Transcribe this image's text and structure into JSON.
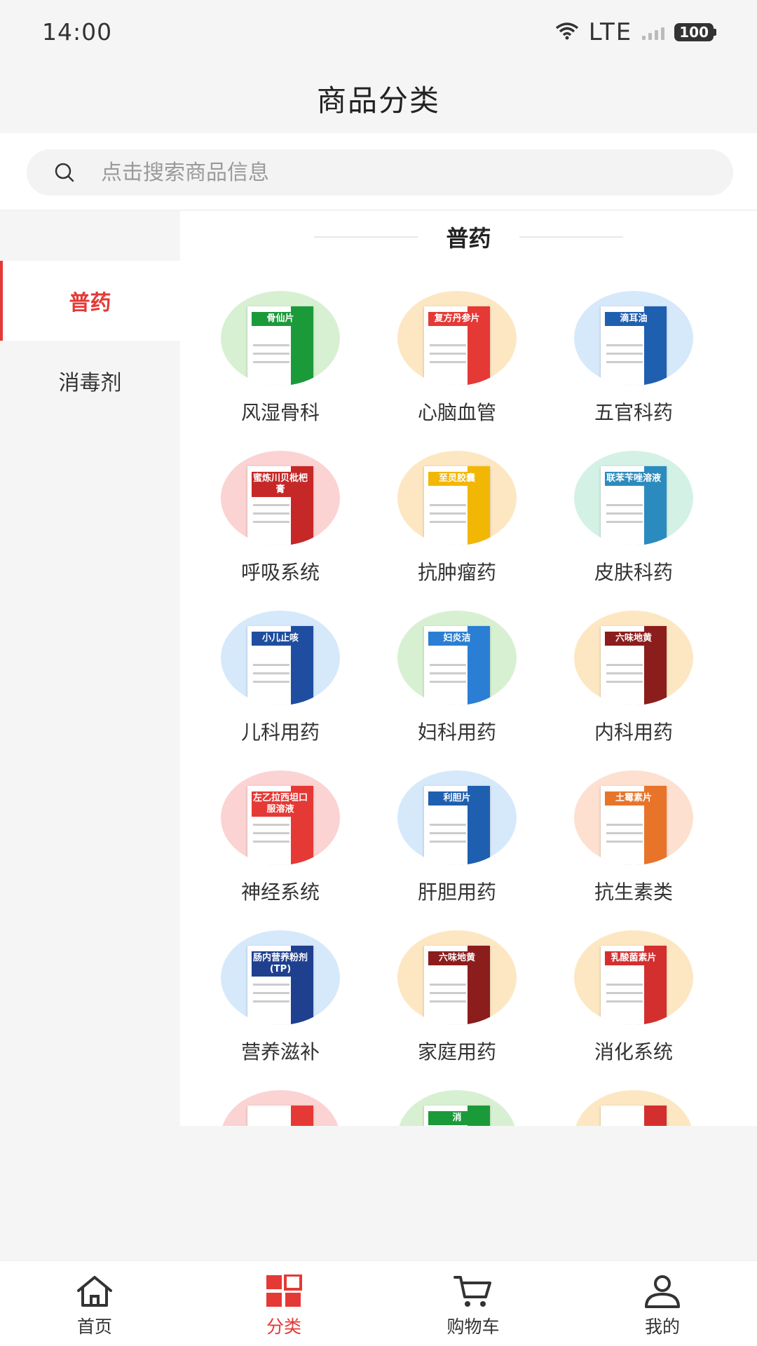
{
  "status_bar": {
    "time": "14:00",
    "network": "LTE",
    "battery": "100"
  },
  "header": {
    "title": "商品分类"
  },
  "search": {
    "placeholder": "点击搜索商品信息"
  },
  "sidebar": {
    "items": [
      {
        "label": "普药",
        "active": true
      },
      {
        "label": "消毒剂",
        "active": false
      }
    ]
  },
  "section": {
    "title": "普药"
  },
  "categories": [
    {
      "label": "风湿骨科",
      "box_text": "骨仙片",
      "circle": "#d7f0d2",
      "accent": "#1b9a3a"
    },
    {
      "label": "心脑血管",
      "box_text": "复方丹参片",
      "circle": "#fde7c2",
      "accent": "#e53935"
    },
    {
      "label": "五官科药",
      "box_text": "滴耳油",
      "circle": "#d6e9fb",
      "accent": "#1f5fb0"
    },
    {
      "label": "呼吸系统",
      "box_text": "蜜炼川贝枇杷膏",
      "circle": "#fbd3d3",
      "accent": "#c62828"
    },
    {
      "label": "抗肿瘤药",
      "box_text": "至灵胶囊",
      "circle": "#fde7c2",
      "accent": "#f2b705"
    },
    {
      "label": "皮肤科药",
      "box_text": "联苯苄唑溶液",
      "circle": "#d4f1e6",
      "accent": "#2b8bbf"
    },
    {
      "label": "儿科用药",
      "box_text": "小儿止咳",
      "circle": "#d6e9fb",
      "accent": "#1f4ea0"
    },
    {
      "label": "妇科用药",
      "box_text": "妇炎洁",
      "circle": "#d7f0d2",
      "accent": "#2a7fd4"
    },
    {
      "label": "内科用药",
      "box_text": "六味地黄",
      "circle": "#fde7c2",
      "accent": "#8b1d1d"
    },
    {
      "label": "神经系统",
      "box_text": "左乙拉西坦口服溶液",
      "circle": "#fbd3d3",
      "accent": "#e53935"
    },
    {
      "label": "肝胆用药",
      "box_text": "利胆片",
      "circle": "#d6e9fb",
      "accent": "#1f5fb0"
    },
    {
      "label": "抗生素类",
      "box_text": "土霉素片",
      "circle": "#fde0d0",
      "accent": "#e8742a"
    },
    {
      "label": "营养滋补",
      "box_text": "肠内营养粉剂(TP)",
      "circle": "#d6e9fb",
      "accent": "#1f3f8f"
    },
    {
      "label": "家庭用药",
      "box_text": "六味地黄",
      "circle": "#fde7c2",
      "accent": "#8b1d1d"
    },
    {
      "label": "消化系统",
      "box_text": "乳酸菌素片",
      "circle": "#fde7c2",
      "accent": "#d32f2f"
    },
    {
      "label": "",
      "box_text": "",
      "circle": "#fbd3d3",
      "accent": "#e53935"
    },
    {
      "label": "",
      "box_text": "消",
      "circle": "#d7f0d2",
      "accent": "#1b9a3a"
    },
    {
      "label": "",
      "box_text": "",
      "circle": "#fde7c2",
      "accent": "#d32f2f"
    }
  ],
  "tabbar": {
    "items": [
      {
        "label": "首页",
        "icon": "home-icon",
        "active": false
      },
      {
        "label": "分类",
        "icon": "category-grid-icon",
        "active": true
      },
      {
        "label": "购物车",
        "icon": "cart-icon",
        "active": false
      },
      {
        "label": "我的",
        "icon": "user-icon",
        "active": false
      }
    ]
  },
  "colors": {
    "accent": "#e53935",
    "background": "#f5f5f5"
  }
}
